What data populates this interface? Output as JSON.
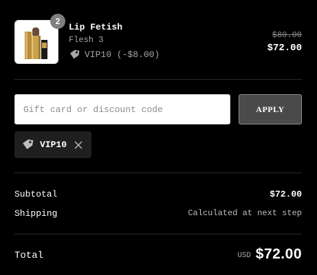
{
  "line_item": {
    "image_alt": "Lip Fetish lipstick",
    "quantity": "2",
    "name": "Lip Fetish",
    "variant": "Flesh 3",
    "discount_text": "VIP10 (-$8.00)",
    "original_price": "$80.00",
    "price": "$72.00"
  },
  "discount": {
    "placeholder": "Gift card or discount code",
    "value": "",
    "apply_label": "APPLY",
    "applied_code": "VIP10"
  },
  "summary": {
    "subtotal_label": "Subtotal",
    "subtotal_value": "$72.00",
    "shipping_label": "Shipping",
    "shipping_value": "Calculated at next step",
    "total_label": "Total",
    "currency": "USD",
    "total_value": "$72.00"
  },
  "icons": {
    "tag": "tag-icon",
    "remove": "close-icon"
  },
  "colors": {
    "background": "#000000",
    "apply_button": "#4a4a4a",
    "applied_tag_bg": "#1f1f1f",
    "muted_text": "#a6a6a6",
    "badge": "#7f7f7f"
  }
}
